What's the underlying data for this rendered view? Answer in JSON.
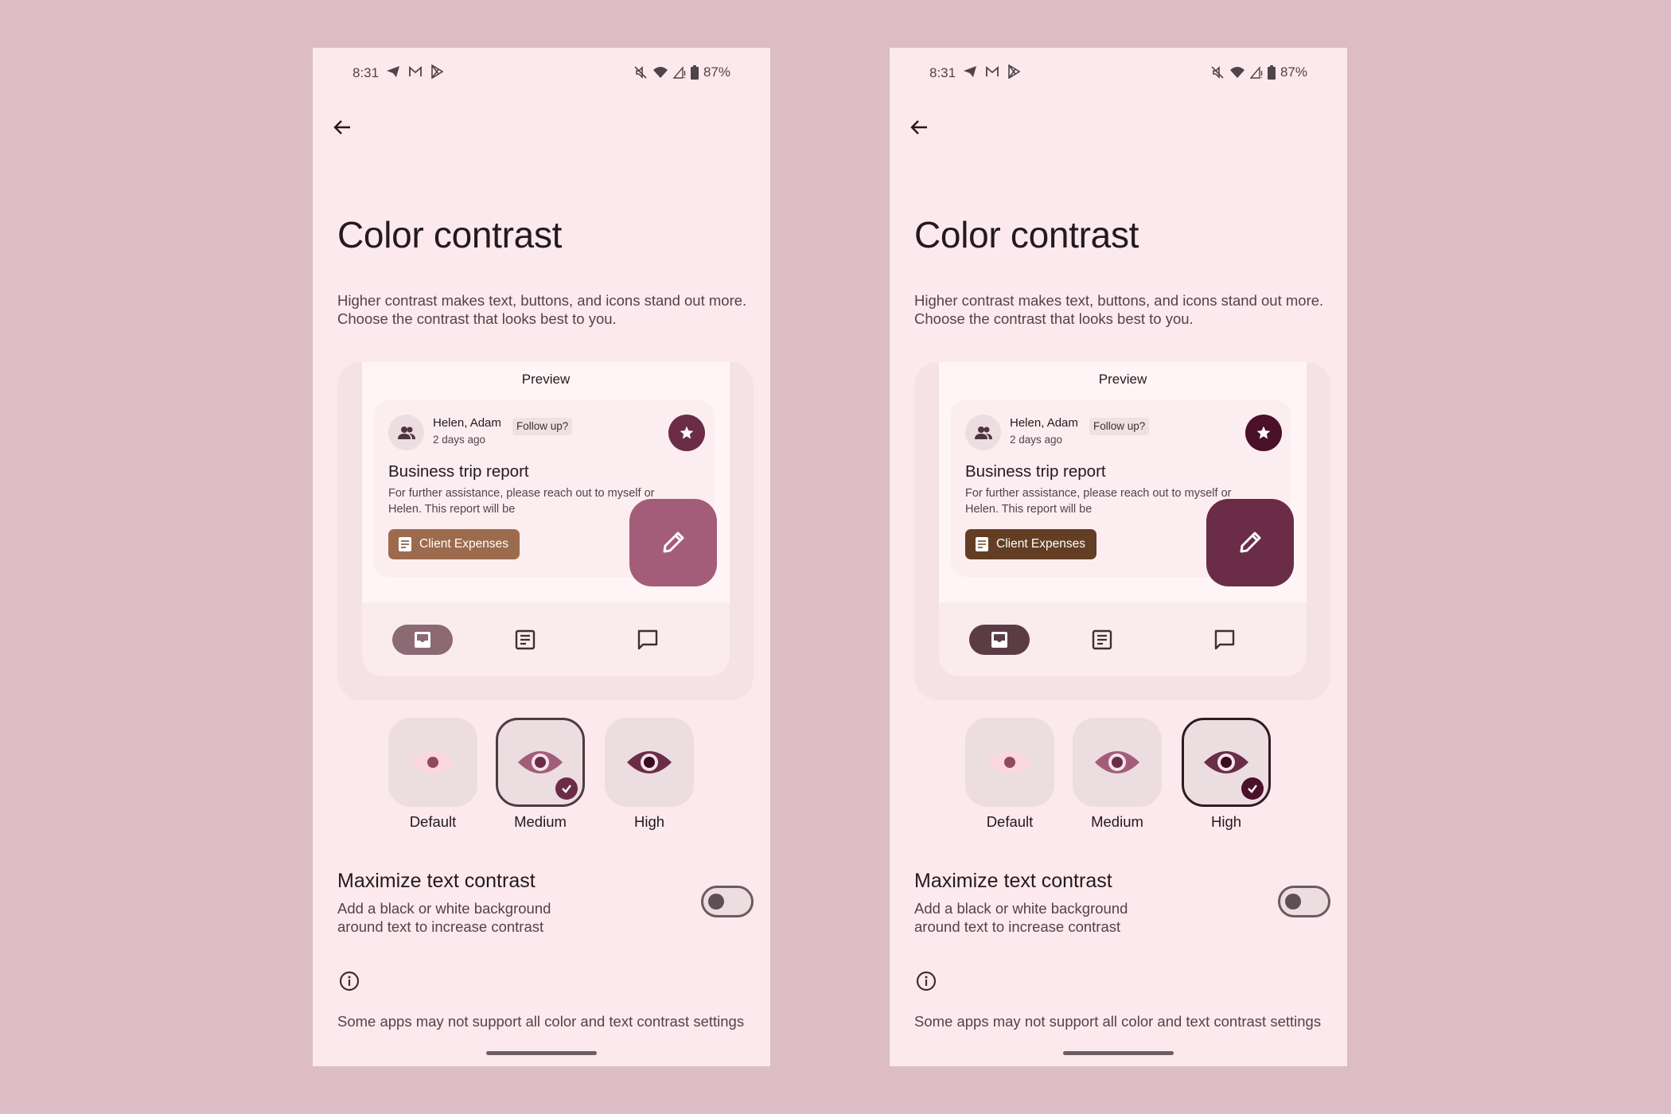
{
  "phones": [
    {
      "id": "left",
      "status_bar": {
        "time": "8:31",
        "battery": "87%",
        "left_icons": [
          "telegram-icon",
          "gmail-icon",
          "play-store-icon"
        ],
        "right_icons": [
          "mute-icon",
          "wifi-icon",
          "signal-icon",
          "battery-icon"
        ]
      },
      "title": "Color contrast",
      "description": "Higher contrast makes text, buttons, and icons stand out more. Choose the contrast that looks best to you.",
      "preview": {
        "label": "Preview",
        "sender": "Helen, Adam",
        "chip": "Follow up?",
        "time_ago": "2 days ago",
        "subject": "Business trip report",
        "body_line1": "For further assistance, please reach out to myself or",
        "body_line2": "Helen. This report will be",
        "attachment": "Client Expenses"
      },
      "options": [
        {
          "label": "Default",
          "selected": false
        },
        {
          "label": "Medium",
          "selected": true
        },
        {
          "label": "High",
          "selected": false
        }
      ],
      "selected_option": "Medium",
      "colors": {
        "accent": "#a45d78",
        "star": "#6b2c47",
        "attachment": "#9c6b4e",
        "nav_pill": "#8b6a74",
        "check": "#6b2c47",
        "selected_border": "#4f3a41"
      },
      "maximize": {
        "title": "Maximize text contrast",
        "description": "Add a black or white background around text to increase contrast",
        "enabled": false
      },
      "footer_note": "Some apps may not support all color and text contrast settings"
    },
    {
      "id": "right",
      "status_bar": {
        "time": "8:31",
        "battery": "87%",
        "left_icons": [
          "telegram-icon",
          "gmail-icon",
          "play-store-icon"
        ],
        "right_icons": [
          "mute-icon",
          "wifi-icon",
          "signal-icon",
          "battery-icon"
        ]
      },
      "title": "Color contrast",
      "description": "Higher contrast makes text, buttons, and icons stand out more. Choose the contrast that looks best to you.",
      "preview": {
        "label": "Preview",
        "sender": "Helen, Adam",
        "chip": "Follow up?",
        "time_ago": "2 days ago",
        "subject": "Business trip report",
        "body_line1": "For further assistance, please reach out to myself or",
        "body_line2": "Helen. This report will be",
        "attachment": "Client Expenses"
      },
      "options": [
        {
          "label": "Default",
          "selected": false
        },
        {
          "label": "Medium",
          "selected": false
        },
        {
          "label": "High",
          "selected": true
        }
      ],
      "selected_option": "High",
      "colors": {
        "accent": "#6b2c47",
        "star": "#4a1128",
        "attachment": "#633e24",
        "nav_pill": "#5b3c45",
        "check": "#4a1128",
        "selected_border": "#2e1a21"
      },
      "maximize": {
        "title": "Maximize text contrast",
        "description": "Add a black or white background around text to increase contrast",
        "enabled": false
      },
      "footer_note": "Some apps may not support all color and text contrast settings"
    }
  ]
}
